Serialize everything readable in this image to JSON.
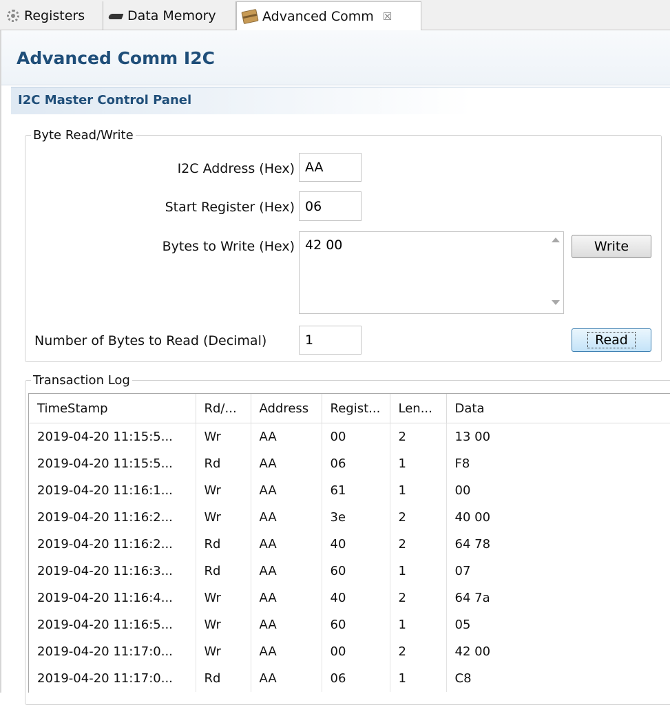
{
  "tabs": [
    {
      "label": "Registers",
      "icon": "gear-icon"
    },
    {
      "label": "Data Memory",
      "icon": "chip-icon"
    },
    {
      "label": "Advanced Comm",
      "icon": "package-icon",
      "close": "☒"
    }
  ],
  "form": {
    "title": "Advanced Comm I2C"
  },
  "section": {
    "title": "I2C Master Control Panel"
  },
  "byte_rw": {
    "legend": "Byte Read/Write",
    "address_label": "I2C Address (Hex)",
    "address_value": "AA",
    "start_reg_label": "Start Register (Hex)",
    "start_reg_value": "06",
    "bytes_write_label": "Bytes to Write (Hex)",
    "bytes_write_value": "42 00",
    "write_button": "Write",
    "num_read_label": "Number of Bytes to Read (Decimal)",
    "num_read_value": "1",
    "read_button": "Read"
  },
  "log": {
    "legend": "Transaction Log",
    "columns": [
      "TimeStamp",
      "Rd/...",
      "Address",
      "Regist...",
      "Len...",
      "Data"
    ],
    "rows": [
      [
        "2019-04-20 11:15:5...",
        "Wr",
        "AA",
        "00",
        "2",
        "13 00"
      ],
      [
        "2019-04-20 11:15:5...",
        "Rd",
        "AA",
        "06",
        "1",
        "F8"
      ],
      [
        "2019-04-20 11:16:1...",
        "Wr",
        "AA",
        "61",
        "1",
        "00"
      ],
      [
        "2019-04-20 11:16:2...",
        "Wr",
        "AA",
        "3e",
        "2",
        "40 00"
      ],
      [
        "2019-04-20 11:16:2...",
        "Rd",
        "AA",
        "40",
        "2",
        "64 78"
      ],
      [
        "2019-04-20 11:16:3...",
        "Rd",
        "AA",
        "60",
        "1",
        "07"
      ],
      [
        "2019-04-20 11:16:4...",
        "Wr",
        "AA",
        "40",
        "2",
        "64 7a"
      ],
      [
        "2019-04-20 11:16:5...",
        "Wr",
        "AA",
        "60",
        "1",
        "05"
      ],
      [
        "2019-04-20 11:17:0...",
        "Wr",
        "AA",
        "00",
        "2",
        "42 00"
      ],
      [
        "2019-04-20 11:17:0...",
        "Rd",
        "AA",
        "06",
        "1",
        "C8"
      ]
    ]
  }
}
